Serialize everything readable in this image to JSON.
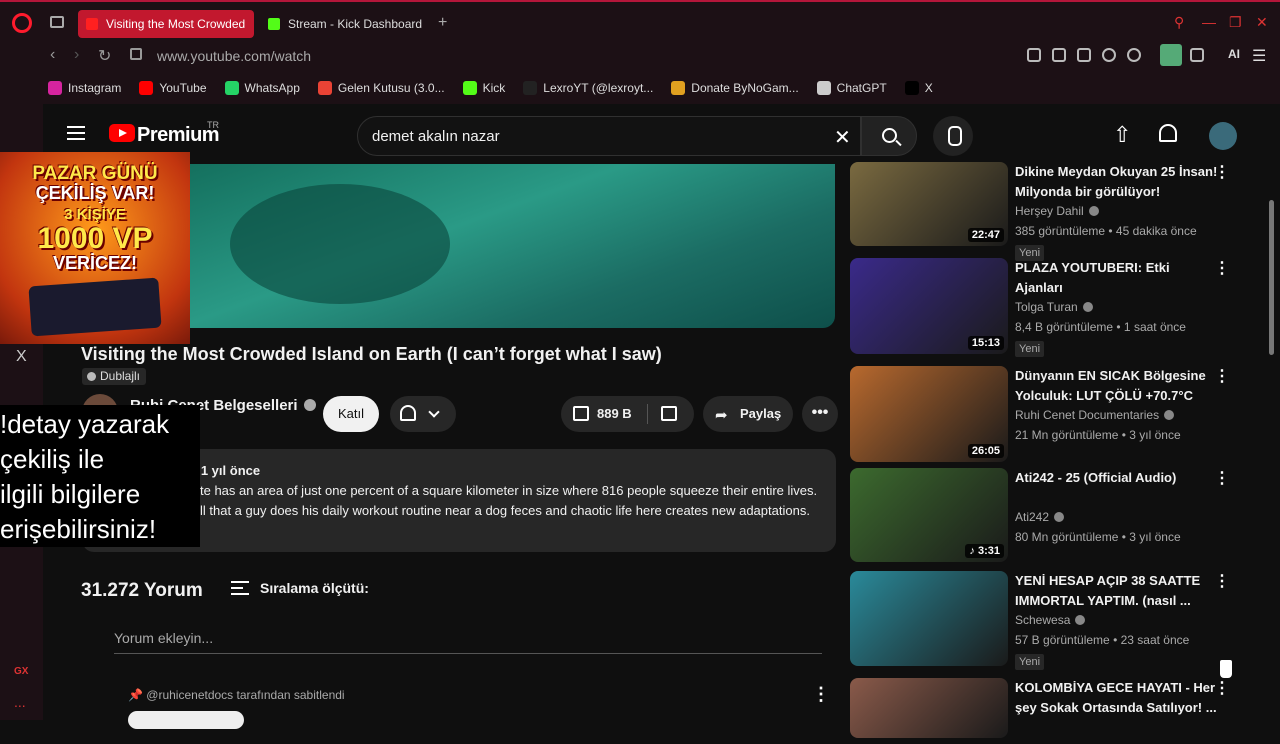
{
  "browser": {
    "tabs": [
      {
        "label": "Visiting the Most Crowded",
        "active": true
      },
      {
        "label": "Stream - Kick Dashboard",
        "active": false
      }
    ],
    "url": "www.youtube.com/watch",
    "ai_label": "AI",
    "bookmarks": [
      {
        "label": "Instagram",
        "color": "#d6249f"
      },
      {
        "label": "YouTube",
        "color": "#ff0000"
      },
      {
        "label": "WhatsApp",
        "color": "#25d366"
      },
      {
        "label": "Gelen Kutusu (3.0...",
        "color": "#ea4335"
      },
      {
        "label": "Kick",
        "color": "#53fc18"
      },
      {
        "label": "LexroYT (@lexroyt...",
        "color": "#222222"
      },
      {
        "label": "Donate ByNoGam...",
        "color": "#e0a020"
      },
      {
        "label": "ChatGPT",
        "color": "#cccccc"
      },
      {
        "label": "X",
        "color": "#000000"
      }
    ],
    "sidebar": {
      "x_label": "X",
      "gx_label": "GX",
      "dots": "..."
    }
  },
  "youtube": {
    "logo_text": "Premium",
    "region": "TR",
    "search_query": "demet akalın nazar",
    "clear_symbol": "✕",
    "upload_symbol": "⇧"
  },
  "promo": {
    "line1": "PAZAR GÜNÜ",
    "line2": "ÇEKİLİŞ VAR!",
    "line3": "3 KİŞİYE",
    "line4": "1000 VP",
    "line5": "VERİCEZ!"
  },
  "video": {
    "title": "Visiting the Most Crowded Island on Earth (I can’t forget what I saw)",
    "dub_label": "Dublajlı",
    "channel": "Ruhi Cenet Belgeselleri",
    "join_label": "Katıl",
    "likes": "889 B",
    "share_label": "Paylaş",
    "more": "•••"
  },
  "overlay": {
    "lines": [
      "!detay yazarak",
      "çekiliş ile",
      "ilgili bilgilere",
      "erişebilirsiniz!"
    ]
  },
  "description": {
    "meta": "e  1 yıl önce",
    "line1": "te has an area of just one percent of a square kilometer in size where 816 people squeeze their entire lives.",
    "line2": "ll that a guy does his daily workout routine near a dog feces and chaotic life here creates new adaptations."
  },
  "comments": {
    "count": "31.272 Yorum",
    "sort_label": "Sıralama ölçütü:",
    "add_placeholder": "Yorum ekleyin...",
    "pinned_by": "@ruhicenetdocs tarafından sabitlendi"
  },
  "recommendations": [
    {
      "title": "Dikine Meydan Okuyan 25 İnsan! Milyonda bir görülüyor!",
      "channel": "Herşey Dahil",
      "stats": "385 görüntüleme • 45 dakika önce",
      "duration": "22:47",
      "new": "Yeni",
      "thumb_color": "#7a6a40"
    },
    {
      "title": "PLAZA YOUTUBERI: Etki Ajanları",
      "channel": "Tolga Turan",
      "stats": "8,4 B görüntüleme • 1 saat önce",
      "duration": "15:13",
      "new": "Yeni",
      "thumb_color": "#3a2a8a"
    },
    {
      "title": "Dünyanın EN SICAK Bölgesine Yolculuk: LUT ÇÖLÜ +70.7°C",
      "channel": "Ruhi Cenet Documentaries",
      "stats": "21 Mn görüntüleme • 3 yıl önce",
      "duration": "26:05",
      "new": "",
      "thumb_color": "#b8692e"
    },
    {
      "title": "Ati242 - 25 (Official Audio)",
      "channel": "Ati242",
      "stats": "80 Mn görüntüleme • 3 yıl önce",
      "duration": "♪ 3:31",
      "new": "",
      "thumb_color": "#3c6a2e"
    },
    {
      "title": "YENİ HESAP AÇIP 38 SAATTE IMMORTAL YAPTIM. (nasıl ...",
      "channel": "Schewesa",
      "stats": "57 B görüntüleme • 23 saat önce",
      "duration": "",
      "new": "Yeni",
      "thumb_color": "#2a8a9a"
    },
    {
      "title": "KOLOMBİYA GECE HAYATI - Her şey Sokak Ortasında Satılıyor! ...",
      "channel": "",
      "stats": "",
      "duration": "",
      "new": "",
      "thumb_color": "#8a5a4a"
    }
  ],
  "colors": {
    "accent": "#ff0000",
    "opera_red": "#c2182e",
    "bg": "#0f0f0f"
  }
}
